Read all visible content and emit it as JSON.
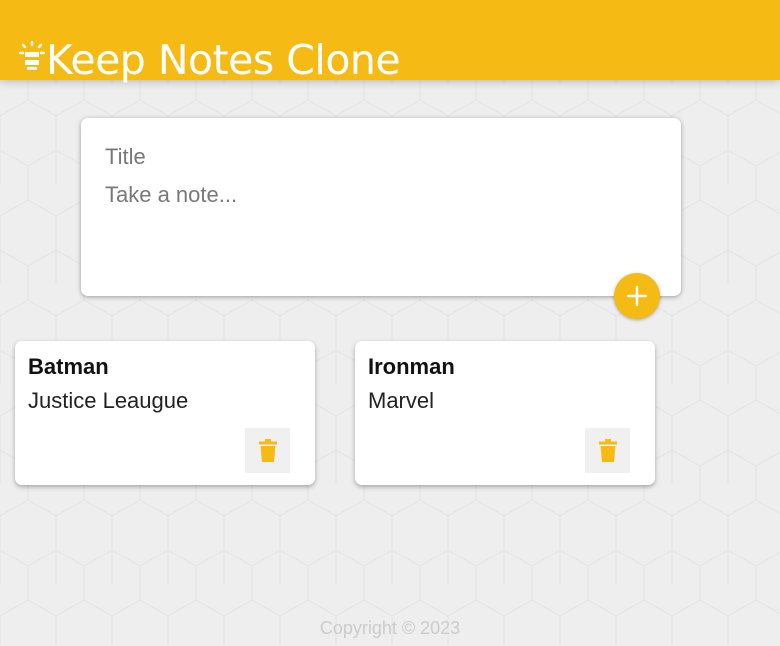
{
  "header": {
    "title": "Keep Notes Clone",
    "icon": "lightbulb-icon",
    "background_color": "#f5ba13"
  },
  "create_note": {
    "title_placeholder": "Title",
    "content_placeholder": "Take a note...",
    "add_icon": "plus-icon"
  },
  "notes": [
    {
      "title": "Batman",
      "content": "Justice Leaugue",
      "delete_icon": "trash-icon"
    },
    {
      "title": "Ironman",
      "content": "Marvel",
      "delete_icon": "trash-icon"
    }
  ],
  "footer": {
    "copyright": "Copyright © 2023"
  },
  "colors": {
    "accent": "#f5ba13",
    "background": "#eeeeee",
    "card": "#ffffff"
  }
}
